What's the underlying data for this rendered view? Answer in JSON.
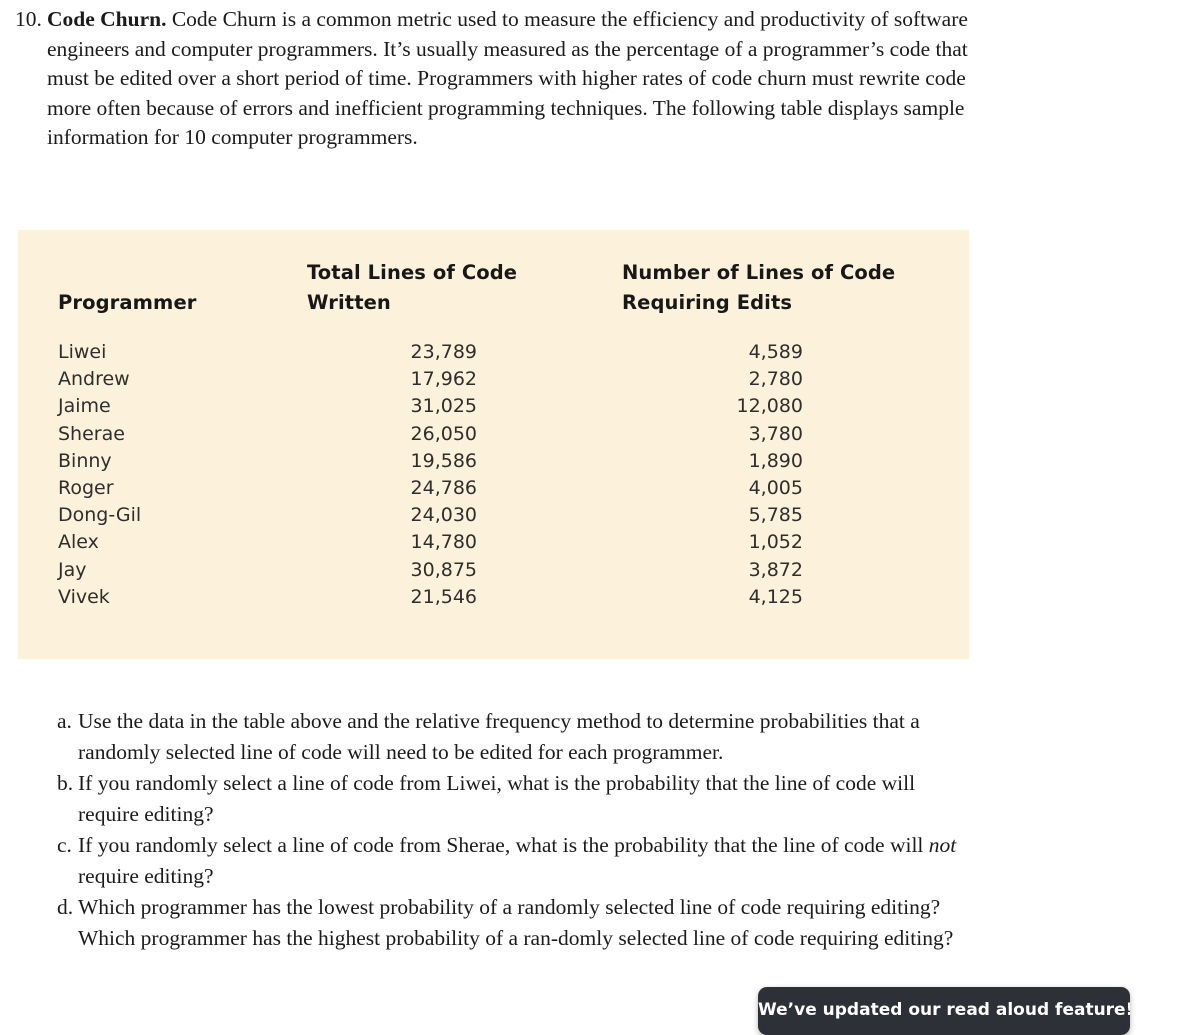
{
  "problem": {
    "number": "10.",
    "title": "Code Churn.",
    "body": " Code Churn is a common metric used to measure the efficiency and productivity of software engineers and computer programmers. It’s usually measured as the percentage of a programmer’s code that must be edited over a short period of time. Programmers with higher rates of code churn must rewrite code more often because of errors and inefficient programming techniques. The following table displays sample information for 10 computer programmers."
  },
  "table": {
    "background_color": "#fcf2db",
    "headers": {
      "programmer": "Programmer",
      "total_lines_line1": "Total Lines of Code",
      "total_lines_line2": "Written",
      "edits_line1": "Number of Lines of Code",
      "edits_line2": "Requiring Edits"
    },
    "rows": [
      {
        "programmer": "Liwei",
        "total_lines": "23,789",
        "lines_requiring_edits": "4,589"
      },
      {
        "programmer": "Andrew",
        "total_lines": "17,962",
        "lines_requiring_edits": "2,780"
      },
      {
        "programmer": "Jaime",
        "total_lines": "31,025",
        "lines_requiring_edits": "12,080"
      },
      {
        "programmer": "Sherae",
        "total_lines": "26,050",
        "lines_requiring_edits": "3,780"
      },
      {
        "programmer": "Binny",
        "total_lines": "19,586",
        "lines_requiring_edits": "1,890"
      },
      {
        "programmer": "Roger",
        "total_lines": "24,786",
        "lines_requiring_edits": "4,005"
      },
      {
        "programmer": "Dong-Gil",
        "total_lines": "24,030",
        "lines_requiring_edits": "5,785"
      },
      {
        "programmer": "Alex",
        "total_lines": "14,780",
        "lines_requiring_edits": "1,052"
      },
      {
        "programmer": "Jay",
        "total_lines": "30,875",
        "lines_requiring_edits": "3,872"
      },
      {
        "programmer": "Vivek",
        "total_lines": "21,546",
        "lines_requiring_edits": "4,125"
      }
    ]
  },
  "questions": [
    {
      "letter": "a.",
      "text": "Use the data in the table above and the relative frequency method to determine probabilities that a randomly selected line of code will need to be edited for each programmer."
    },
    {
      "letter": "b.",
      "text": "If you randomly select a line of code from Liwei, what is the probability that the line of code will require editing?"
    },
    {
      "letter": "c.",
      "text_before_italic": "If you randomly select a line of code from Sherae, what is the probability that the line of code will ",
      "italic": "not",
      "text_after_italic": " require editing?"
    },
    {
      "letter": "d.",
      "text": "Which programmer has the lowest probability of a randomly selected line of code requiring editing? Which programmer has the highest probability of a ran-domly selected line of code requiring editing?"
    }
  ],
  "toast": {
    "message": "We’ve updated our read aloud feature!",
    "background_color": "#2e3038",
    "text_color": "#ffffff"
  }
}
